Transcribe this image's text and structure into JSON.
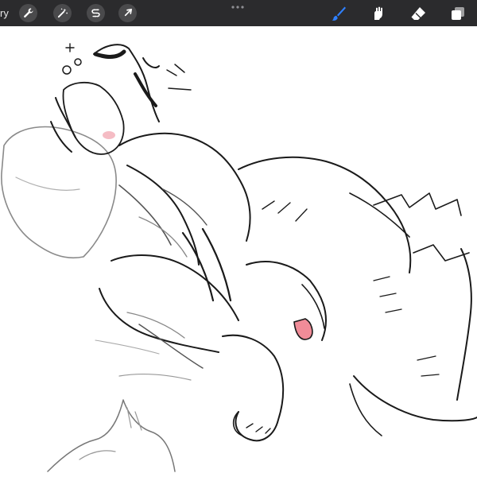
{
  "topbar": {
    "gallery_label": "ry",
    "left_tools": [
      {
        "name": "actions",
        "icon": "wrench-icon"
      },
      {
        "name": "adjustments",
        "icon": "magic-wand-icon"
      },
      {
        "name": "selection",
        "icon": "selection-s-icon"
      },
      {
        "name": "transform",
        "icon": "arrow-cursor-icon"
      }
    ],
    "more_icon": "more-dots-icon",
    "right_tools": [
      {
        "name": "brush",
        "icon": "brush-icon",
        "active": true
      },
      {
        "name": "smudge",
        "icon": "smudge-icon",
        "active": false
      },
      {
        "name": "eraser",
        "icon": "eraser-icon",
        "active": false
      },
      {
        "name": "layers",
        "icon": "layers-icon",
        "active": false
      }
    ],
    "colors": {
      "bar": "#2b2b2d",
      "active": "#2f80ff",
      "inactive": "#ffffff"
    }
  },
  "canvas": {
    "content": "sketch-drawing",
    "background": "#ffffff"
  }
}
